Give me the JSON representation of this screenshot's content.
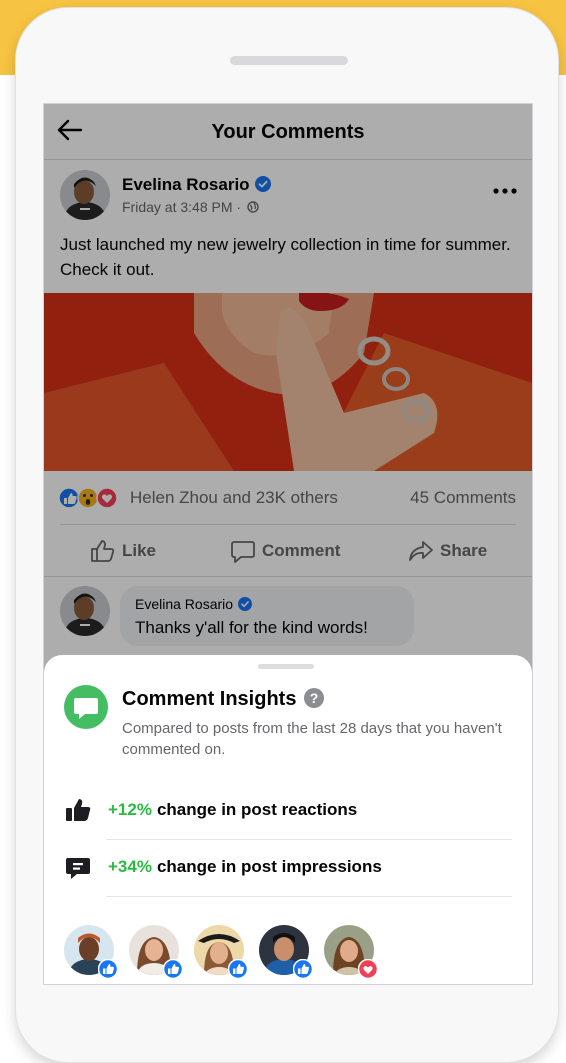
{
  "header": {
    "title": "Your Comments"
  },
  "post": {
    "author": "Evelina Rosario",
    "meta": "Friday at 3:48 PM ·",
    "text": "Just launched my new jewelry collection in time for summer. Check it out.",
    "reactions_text": "Helen Zhou and 23K others",
    "comments_count": "45 Comments"
  },
  "actions": {
    "like": "Like",
    "comment": "Comment",
    "share": "Share"
  },
  "comment": {
    "author": "Evelina Rosario",
    "text": "Thanks y'all for the kind words!"
  },
  "insights": {
    "title": "Comment Insights",
    "description": "Compared to posts from the last 28 days that you haven't commented on.",
    "stats": [
      {
        "value": "+12%",
        "label": "change in post reactions",
        "icon": "thumbs-up-icon"
      },
      {
        "value": "+34%",
        "label": "change in post impressions",
        "icon": "message-icon"
      }
    ]
  },
  "colors": {
    "brand_blue": "#1877F2",
    "positive_green": "#2ABC41",
    "accent_yellow": "#F7C342",
    "insights_green": "#45BD62",
    "love_red": "#F33E58"
  }
}
